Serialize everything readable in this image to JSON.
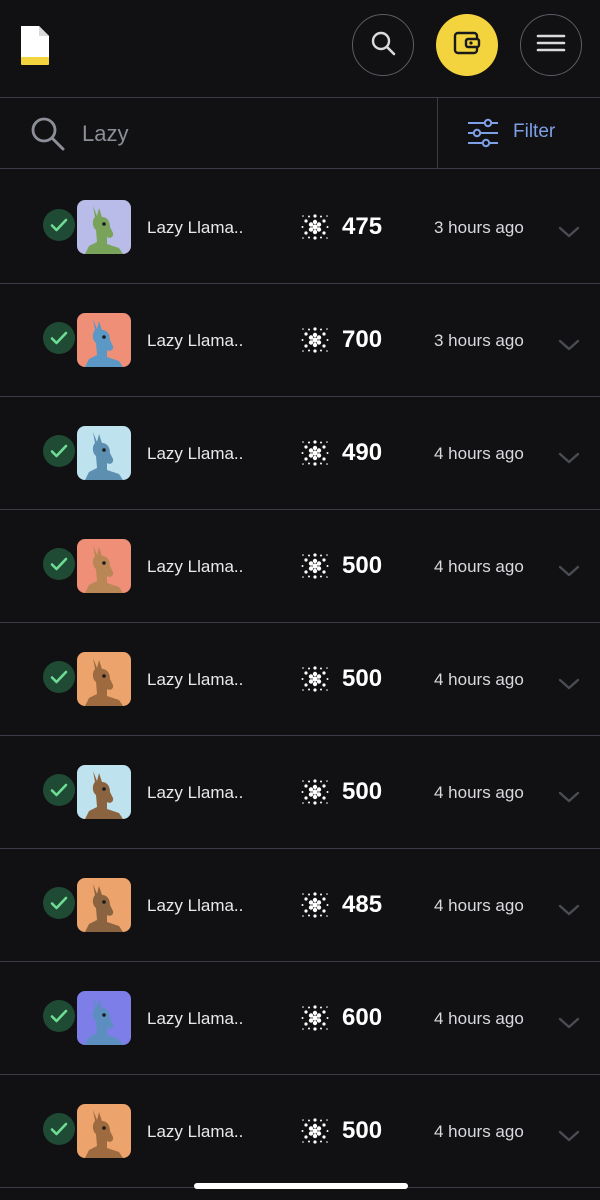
{
  "header": {
    "logo_icon": "document-logo-icon",
    "search_icon": "search-icon",
    "wallet_icon": "wallet-icon",
    "menu_icon": "hamburger-menu-icon",
    "wallet_color": "#f3d33e"
  },
  "search": {
    "value": "Lazy",
    "filter_label": "Filter",
    "filter_color": "#7ea0e6"
  },
  "listings": [
    {
      "name": "Lazy Llama..",
      "price": "475",
      "time": "3 hours ago",
      "avatar_bg": "#b9bce8",
      "avatar_fg": "#79a25a",
      "avatar_icon": "llama-nft-avatar"
    },
    {
      "name": "Lazy Llama..",
      "price": "700",
      "time": "3 hours ago",
      "avatar_bg": "#ef8f78",
      "avatar_fg": "#5b98c6",
      "avatar_icon": "llama-nft-avatar"
    },
    {
      "name": "Lazy Llama..",
      "price": "490",
      "time": "4 hours ago",
      "avatar_bg": "#bfe3ee",
      "avatar_fg": "#5d8fb1",
      "avatar_icon": "llama-nft-avatar"
    },
    {
      "name": "Lazy Llama..",
      "price": "500",
      "time": "4 hours ago",
      "avatar_bg": "#ef8f78",
      "avatar_fg": "#b88755",
      "avatar_icon": "llama-nft-avatar"
    },
    {
      "name": "Lazy Llama..",
      "price": "500",
      "time": "4 hours ago",
      "avatar_bg": "#eda36c",
      "avatar_fg": "#9d6b3f",
      "avatar_icon": "llama-nft-avatar"
    },
    {
      "name": "Lazy Llama..",
      "price": "500",
      "time": "4 hours ago",
      "avatar_bg": "#bfe3ee",
      "avatar_fg": "#8a6440",
      "avatar_icon": "llama-nft-avatar"
    },
    {
      "name": "Lazy Llama..",
      "price": "485",
      "time": "4 hours ago",
      "avatar_bg": "#eda36c",
      "avatar_fg": "#8a6440",
      "avatar_icon": "llama-nft-avatar"
    },
    {
      "name": "Lazy Llama..",
      "price": "600",
      "time": "4 hours ago",
      "avatar_bg": "#7d7ee8",
      "avatar_fg": "#5c8ec0",
      "avatar_icon": "llama-nft-avatar"
    },
    {
      "name": "Lazy Llama..",
      "price": "500",
      "time": "4 hours ago",
      "avatar_bg": "#eda36c",
      "avatar_fg": "#9d6b3f",
      "avatar_icon": "llama-nft-avatar"
    }
  ],
  "icons": {
    "verified": "verified-check-icon",
    "currency": "cardano-ada-icon",
    "expand": "chevron-down-icon"
  },
  "colors": {
    "background": "#111113",
    "divider": "#3a3d46",
    "verified_bg": "#1f4a33",
    "verified_check": "#6fdc95"
  }
}
